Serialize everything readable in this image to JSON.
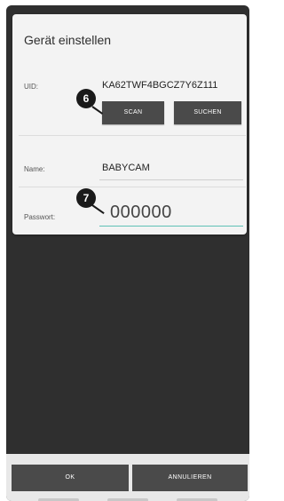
{
  "dialog": {
    "title": "Gerät einstellen",
    "uid": {
      "label": "UID:",
      "value": "KA62TWF4BGCZ7Y6Z111"
    },
    "buttons": {
      "scan": "SCAN",
      "search": "SUCHEN"
    },
    "name": {
      "label": "Name:",
      "value": "BABYCAM"
    },
    "password": {
      "label": "Passwort:",
      "value": "000000"
    },
    "markers": {
      "scan": "6",
      "password": "7"
    }
  },
  "footer": {
    "ok_label": "OK",
    "cancel_label": "ANNULIEREN"
  },
  "colors": {
    "dialog_bg": "#f3f3f3",
    "backdrop": "#2f2f2f",
    "button": "#4a4a4a",
    "focus_underline": "#5fc1b5"
  }
}
